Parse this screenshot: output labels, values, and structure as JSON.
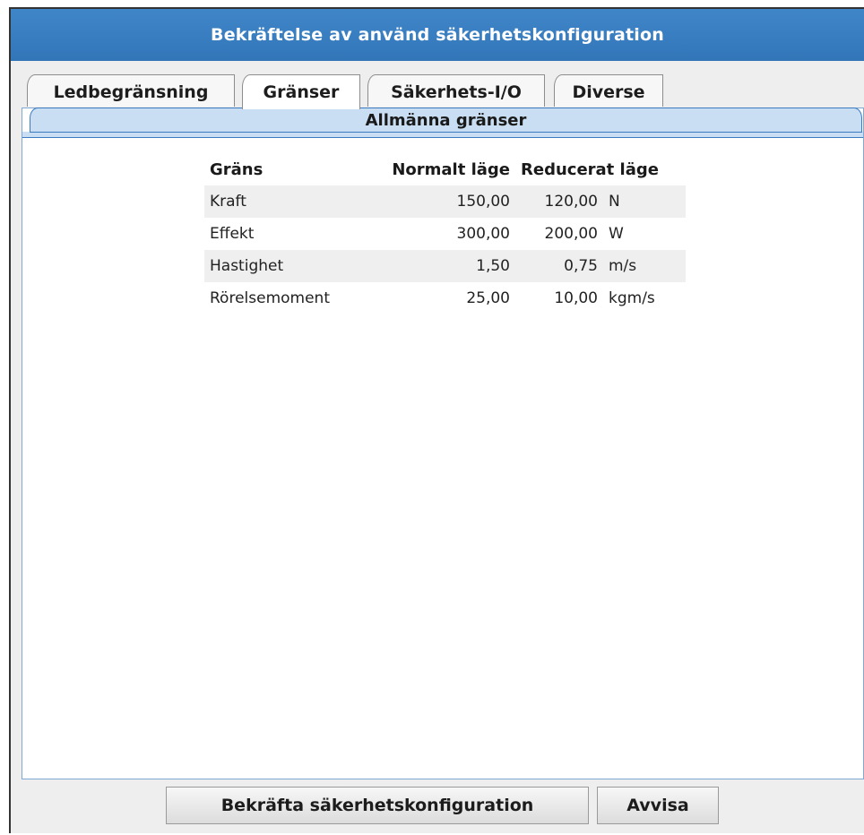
{
  "window": {
    "title": "Bekräftelse av använd säkerhetskonfiguration"
  },
  "tabs": [
    {
      "label": "Ledbegränsning",
      "active": false
    },
    {
      "label": "Gränser",
      "active": true
    },
    {
      "label": "Säkerhets-I/O",
      "active": false
    },
    {
      "label": "Diverse",
      "active": false
    }
  ],
  "subtab": {
    "label": "Allmänna gränser"
  },
  "limits_table": {
    "headers": {
      "limit": "Gräns",
      "normal": "Normalt läge",
      "reduced": "Reducerat läge"
    },
    "rows": [
      {
        "name": "Kraft",
        "normal": "150,00",
        "reduced": "120,00",
        "unit": "N"
      },
      {
        "name": "Effekt",
        "normal": "300,00",
        "reduced": "200,00",
        "unit": "W"
      },
      {
        "name": "Hastighet",
        "normal": "1,50",
        "reduced": "0,75",
        "unit": "m/s"
      },
      {
        "name": "Rörelsemoment",
        "normal": "25,00",
        "reduced": "10,00",
        "unit": "kgm/s"
      }
    ]
  },
  "buttons": {
    "confirm": "Bekräfta säkerhetskonfiguration",
    "reject": "Avvisa"
  }
}
